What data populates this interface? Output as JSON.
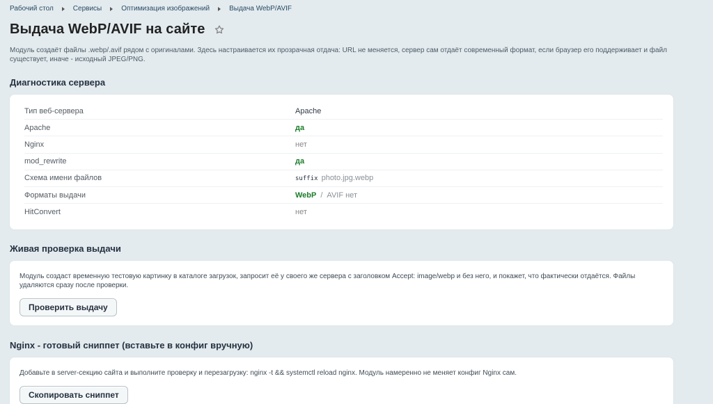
{
  "breadcrumb": {
    "items": [
      "Рабочий стол",
      "Сервисы",
      "Оптимизация изображений",
      "Выдача WebP/AVIF"
    ]
  },
  "page": {
    "title": "Выдача WebP/AVIF на сайте",
    "intro": "Модуль создаёт файлы .webp/.avif рядом с оригиналами. Здесь настраивается их прозрачная отдача: URL не меняется, сервер сам отдаёт современный формат, если браузер его поддерживает и файл существует, иначе - исходный JPEG/PNG."
  },
  "diagnostics": {
    "title": "Диагностика сервера",
    "rows": [
      {
        "label": "Тип веб-сервера",
        "value": "Apache"
      },
      {
        "label": "Apache",
        "value": "да"
      },
      {
        "label": "Nginx",
        "value": "нет"
      },
      {
        "label": "mod_rewrite",
        "value": "да"
      },
      {
        "label": "Схема имени файлов",
        "scheme": "suffix",
        "example": "photo.jpg.webp"
      },
      {
        "label": "Форматы выдачи",
        "webp": "WebP",
        "separator": "/",
        "avif": "AVIF нет"
      },
      {
        "label": "HitConvert",
        "value": "нет"
      }
    ]
  },
  "live_check": {
    "title": "Живая проверка выдачи",
    "text": "Модуль создаст временную тестовую картинку в каталоге загрузок, запросит её у своего же сервера с заголовком Accept: image/webp и без него, и покажет, что фактически отдаётся. Файлы удаляются сразу после проверки.",
    "button": "Проверить выдачу"
  },
  "nginx": {
    "title": "Nginx - готовый сниппет (вставьте в конфиг вручную)",
    "text": "Добавьте в server-секцию сайта и выполните проверку и перезагрузку: nginx -t && systemctl reload nginx. Модуль намеренно не меняет конфиг Nginx сам.",
    "button": "Скопировать сниппет"
  },
  "icons": {
    "favorite": "star-icon",
    "breadcrumb_separator": "chevron-right-icon"
  },
  "colors": {
    "background": "#e3ebee",
    "card": "#ffffff",
    "yes": "#1b7c2b",
    "no": "#888888",
    "link": "#2a4a66"
  }
}
